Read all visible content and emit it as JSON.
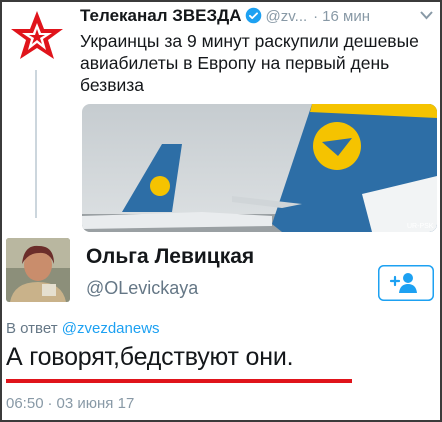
{
  "quoted_tweet": {
    "author_name": "Телеканал ЗВЕЗДА",
    "handle": "@zv...",
    "separator": "·",
    "time": "16 мин",
    "text": "Украинцы за 9 минут раскупили дешевые авиабилеты в Европу на первый день безвиза",
    "image_caption": "UR-PSK",
    "colors": {
      "logo_red": "#e0141b",
      "verified_blue": "#1da1f2",
      "tail_blue": "#2d6ea6",
      "tail_yellow": "#f5c300"
    }
  },
  "reply": {
    "author_name": "Ольга Левицкая",
    "handle": "@OLevickaya",
    "in_reply_to_prefix": "В ответ",
    "in_reply_to_mention": "@zvezdanews",
    "text": "А говорят,бедствуют они.",
    "time": "06:50",
    "separator": "·",
    "date": "03 июня 17",
    "highlight_color": "#e0141b"
  },
  "icons": [
    "zvezda-logo-icon",
    "verified-badge-icon",
    "chevron-down-icon",
    "follow-user-icon"
  ]
}
